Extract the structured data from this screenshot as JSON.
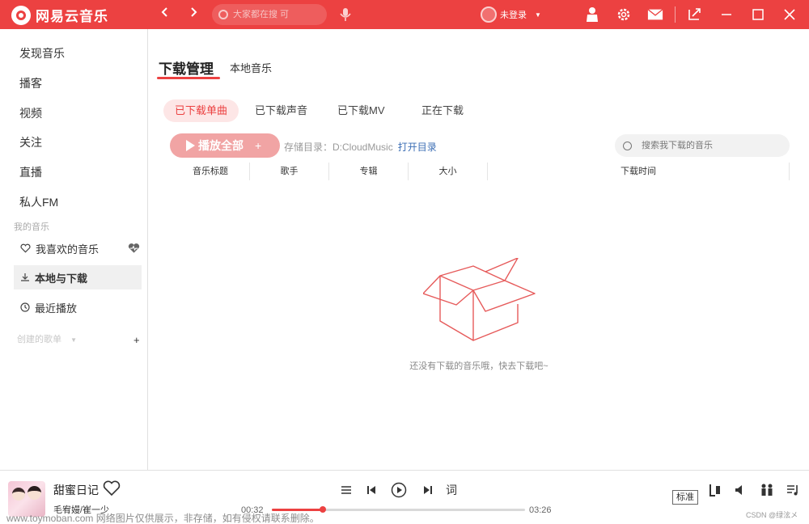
{
  "app": {
    "name": "网易云音乐",
    "search_placeholder": "大家都在搜 可",
    "user_label": "未登录",
    "accent": "#ec4141"
  },
  "sidebar": {
    "nav": [
      "发现音乐",
      "播客",
      "视频",
      "关注",
      "直播",
      "私人FM"
    ],
    "my_music_label": "我的音乐",
    "my_music": [
      {
        "label": "我喜欢的音乐",
        "icon": "heart-icon"
      },
      {
        "label": "本地与下载",
        "icon": "download-icon"
      },
      {
        "label": "最近播放",
        "icon": "clock-icon"
      }
    ],
    "created_playlists_label": "创建的歌单",
    "add_label": "+"
  },
  "main": {
    "tab_active": "下载管理",
    "tab_other": "本地音乐",
    "subtabs": [
      "已下载单曲",
      "已下载声音",
      "已下载MV",
      "正在下载"
    ],
    "play_all_label": "播放全部",
    "play_all_plus": "+",
    "storage_label": "存储目录：D:CloudMusic",
    "open_dir_label": "打开目录",
    "search_placeholder": "搜索我下载的音乐",
    "columns": [
      "音乐标题",
      "歌手",
      "专辑",
      "大小",
      "下载时间"
    ],
    "empty_text": "还没有下载的音乐哦，快去下载吧~"
  },
  "player": {
    "song_title": "甜蜜日记",
    "artist": "毛宥嫚/崔一少",
    "time_current": "00:32",
    "time_total": "03:26",
    "progress": 0.2,
    "lyrics_label": "词",
    "quality_label": "标准",
    "watermark": "www.toymoban.com 网络图片仅供展示，非存储，如有侵权请联系删除。",
    "csdn_label": "CSDN @绿泫メ"
  }
}
